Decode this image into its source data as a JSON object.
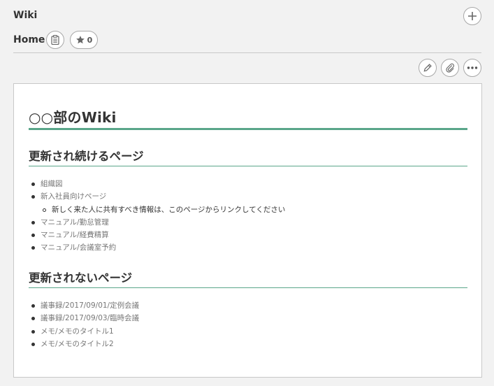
{
  "header": {
    "title": "Wiki",
    "add_icon": "plus-icon"
  },
  "page": {
    "name": "Home",
    "clipboard_icon": "clipboard-icon",
    "star_icon": "star-icon",
    "star_count": "0"
  },
  "toolbar": {
    "edit_icon": "pencil-icon",
    "attach_icon": "paperclip-icon",
    "more_icon": "more-icon"
  },
  "content": {
    "title": "○○部のWiki",
    "sections": [
      {
        "heading": "更新され続けるページ",
        "items": [
          {
            "label": "組織図"
          },
          {
            "label": "新入社員向けページ",
            "sub": [
              "新しく来た人に共有すべき情報は、このページからリンクしてください"
            ]
          },
          {
            "label": "マニュアル/勤怠管理"
          },
          {
            "label": "マニュアル/経費精算"
          },
          {
            "label": "マニュアル/会議室予約"
          }
        ]
      },
      {
        "heading": "更新されないページ",
        "items": [
          {
            "label": "議事録/2017/09/01/定例会議"
          },
          {
            "label": "議事録/2017/09/03/臨時会議"
          },
          {
            "label": "メモ/メモのタイトル1"
          },
          {
            "label": "メモ/メモのタイトル2"
          }
        ]
      }
    ]
  },
  "colors": {
    "background": "#f2f2f2",
    "accent_rule": "#5aa68a",
    "link_text": "#777777",
    "body_text": "#333333"
  }
}
